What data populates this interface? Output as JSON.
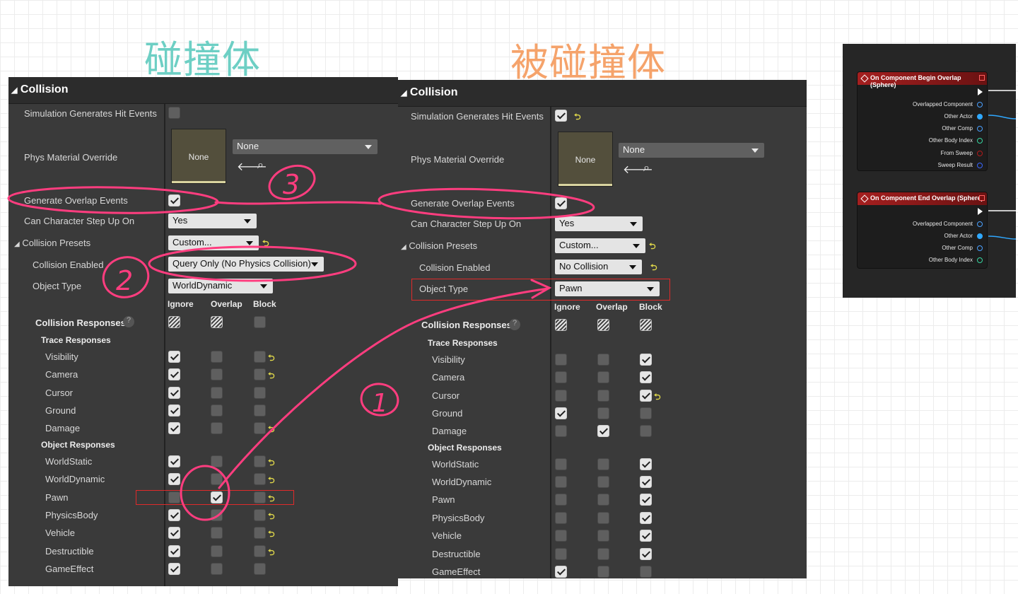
{
  "headings": {
    "left": "碰撞体",
    "right": "被碰撞体"
  },
  "colors": {
    "left_heading": "#6dcfc4",
    "right_heading": "#f5a36b",
    "annotation": "#ff3d7f",
    "highlight_box": "#e02a2a"
  },
  "left": {
    "title": "Collision",
    "sim_hit_label": "Simulation Generates Hit Events",
    "phys_label": "Phys Material Override",
    "phys_thumb": "None",
    "phys_dropdown": "None",
    "gen_overlap_label": "Generate Overlap Events",
    "step_label": "Can Character Step Up On",
    "step_value": "Yes",
    "presets_label": "Collision Presets",
    "presets_value": "Custom...",
    "enabled_label": "Collision Enabled",
    "enabled_value": "Query Only (No Physics Collision)",
    "objtype_label": "Object Type",
    "objtype_value": "WorldDynamic",
    "col_ignore": "Ignore",
    "col_overlap": "Overlap",
    "col_block": "Block",
    "responses_label": "Collision Responses",
    "trace_label": "Trace Responses",
    "object_label": "Object Responses",
    "trace": [
      "Visibility",
      "Camera",
      "Cursor",
      "Ground",
      "Damage"
    ],
    "objects": [
      "WorldStatic",
      "WorldDynamic",
      "Pawn",
      "PhysicsBody",
      "Vehicle",
      "Destructible",
      "GameEffect"
    ]
  },
  "right": {
    "title": "Collision",
    "sim_hit_label": "Simulation Generates Hit Events",
    "phys_label": "Phys Material Override",
    "phys_thumb": "None",
    "phys_dropdown": "None",
    "gen_overlap_label": "Generate Overlap Events",
    "step_label": "Can Character Step Up On",
    "step_value": "Yes",
    "presets_label": "Collision Presets",
    "presets_value": "Custom...",
    "enabled_label": "Collision Enabled",
    "enabled_value": "No Collision",
    "objtype_label": "Object Type",
    "objtype_value": "Pawn",
    "col_ignore": "Ignore",
    "col_overlap": "Overlap",
    "col_block": "Block",
    "responses_label": "Collision Responses",
    "trace_label": "Trace Responses",
    "object_label": "Object Responses",
    "trace": [
      "Visibility",
      "Camera",
      "Cursor",
      "Ground",
      "Damage"
    ],
    "objects": [
      "WorldStatic",
      "WorldDynamic",
      "Pawn",
      "PhysicsBody",
      "Vehicle",
      "Destructible",
      "GameEffect"
    ]
  },
  "nodes": {
    "begin_title": "On Component Begin Overlap (Sphere)",
    "begin_pins": [
      "Overlapped Component",
      "Other Actor",
      "Other Comp",
      "Other Body Index",
      "From Sweep",
      "Sweep Result"
    ],
    "end_title": "On Component End Overlap (Sphere)",
    "end_pins": [
      "Overlapped Component",
      "Other Actor",
      "Other Comp",
      "Other Body Index"
    ]
  },
  "annotations": [
    "1",
    "2",
    "3"
  ]
}
